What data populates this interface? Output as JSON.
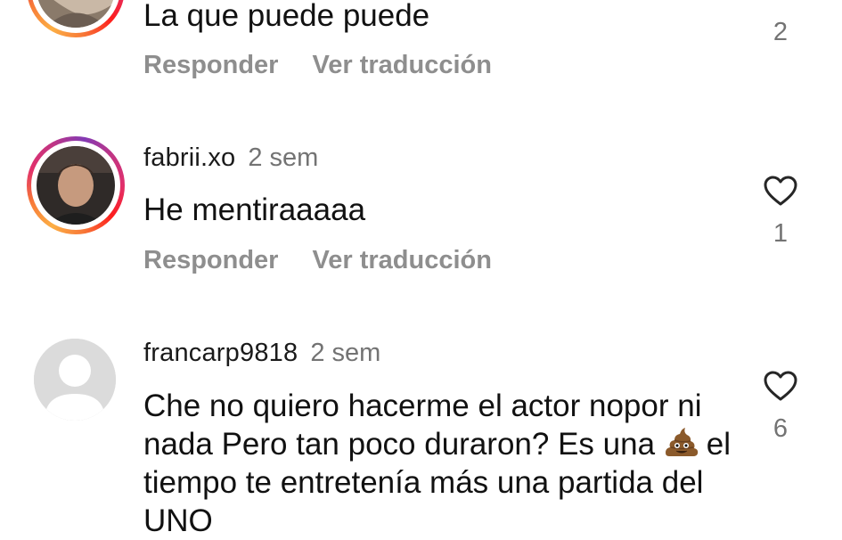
{
  "comments": [
    {
      "username": "",
      "time": "",
      "text": "La que puede puede",
      "likes": "2",
      "reply_label": "Responder",
      "translate_label": "Ver traducción",
      "avatar_icon": "user-photo-avatar",
      "has_story_ring": true
    },
    {
      "username": "fabrii.xo",
      "time": "2 sem",
      "text": "He mentiraaaaa",
      "likes": "1",
      "reply_label": "Responder",
      "translate_label": "Ver traducción",
      "avatar_icon": "user-photo-avatar",
      "has_story_ring": true
    },
    {
      "username": "francarp9818",
      "time": "2 sem",
      "text_before_emoji": "Che no quiero hacerme el actor nopor ni nada Pero tan poco duraron? Es una",
      "emoji": "poop-emoji",
      "text_after_emoji": "el tiempo te entretenía más una partida del UNO",
      "likes": "6",
      "avatar_icon": "default-avatar-icon",
      "has_story_ring": false
    }
  ],
  "icons": {
    "like": "heart-outline-icon",
    "collapse": "chevron-down-icon"
  },
  "colors": {
    "story_ring_start": "#fcaf45",
    "story_ring_end": "#833ab4",
    "secondary_text": "#737373",
    "action_text": "#8e8e8e"
  }
}
